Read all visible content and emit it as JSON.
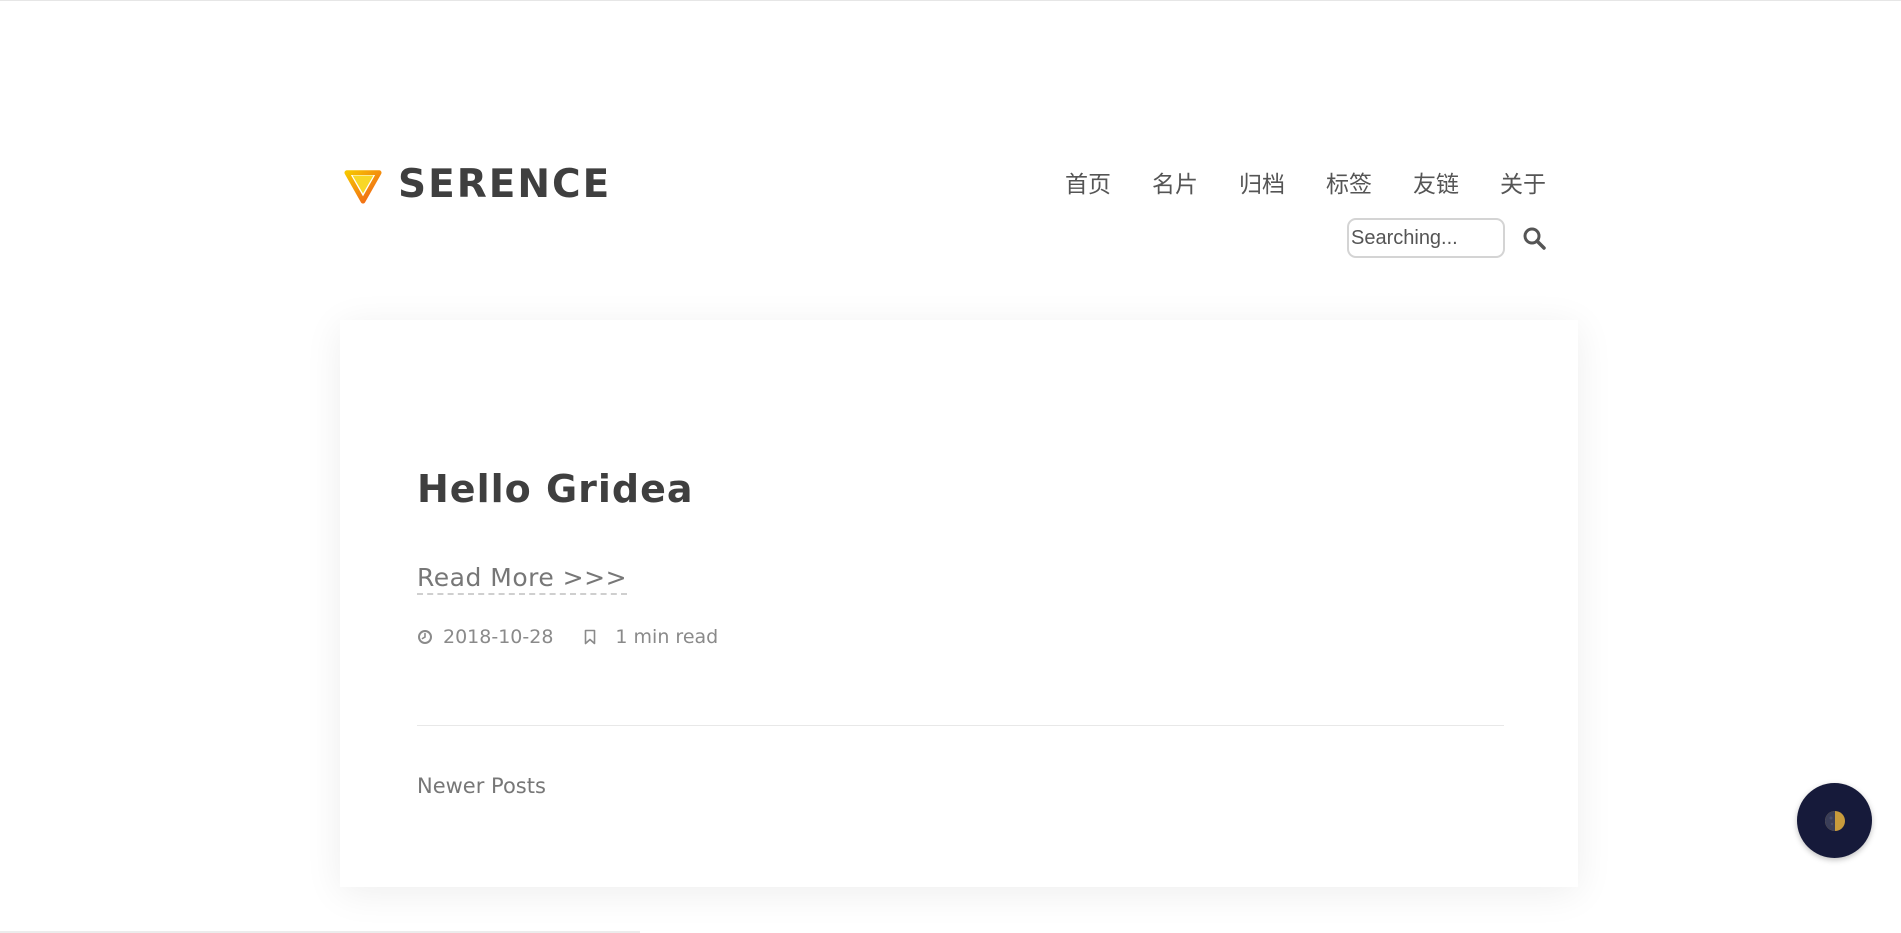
{
  "site": {
    "logo_text": "SERENCE"
  },
  "nav": {
    "items": [
      "首页",
      "名片",
      "归档",
      "标签",
      "友链",
      "关于"
    ]
  },
  "search": {
    "placeholder": "Searching..."
  },
  "post": {
    "title": "Hello Gridea",
    "read_more": "Read More >>>",
    "date": "2018-10-28",
    "read_time": "1 min read"
  },
  "pagination": {
    "newer_label": "Newer Posts"
  },
  "colors": {
    "logo_gradient": [
      "#f7c600",
      "#f05a1a"
    ],
    "theme_toggle_bg": "#161a3a",
    "moon_color": "#c89b3c"
  },
  "icons": {
    "logo": "triangle-logo-icon",
    "search": "search-icon",
    "date": "clock-icon",
    "bookmark": "bookmark-icon",
    "theme_toggle": "moon-icon"
  }
}
